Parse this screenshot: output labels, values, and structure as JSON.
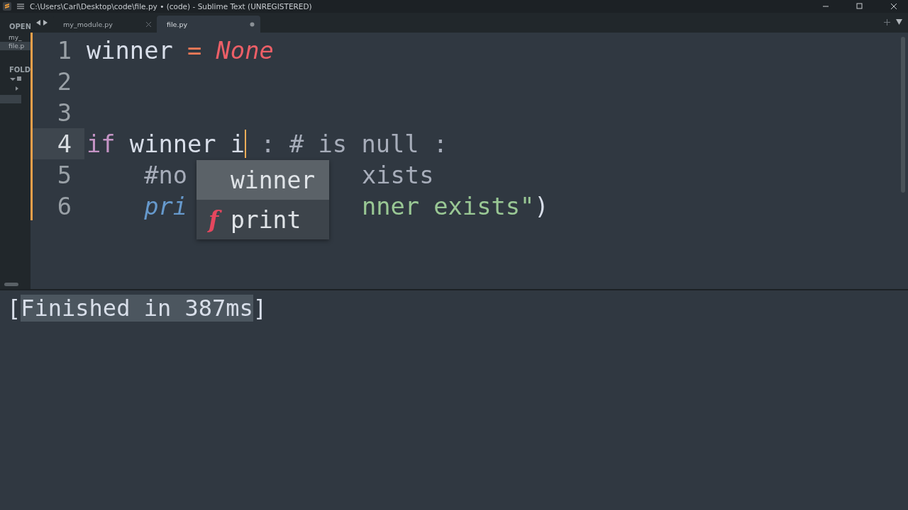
{
  "window": {
    "title": "C:\\Users\\Carl\\Desktop\\code\\file.py • (code) - Sublime Text (UNREGISTERED)"
  },
  "sidebar": {
    "open_header": "OPEN",
    "open_files": [
      {
        "label": "my_",
        "selected": false
      },
      {
        "label": "file.p",
        "selected": true
      }
    ],
    "folders_header": "FOLD"
  },
  "tabs": [
    {
      "label": "my_module.py",
      "selected": false,
      "dirty": false
    },
    {
      "label": "file.py",
      "selected": true,
      "dirty": true
    }
  ],
  "editor": {
    "lines": [
      {
        "number": "1",
        "current": false,
        "tokens": [
          {
            "text": "winner ",
            "kind": "plain"
          },
          {
            "text": "= ",
            "kind": "operator"
          },
          {
            "text": "None",
            "kind": "constant"
          }
        ]
      },
      {
        "number": "2",
        "current": false
      },
      {
        "number": "3",
        "current": false
      },
      {
        "number": "4",
        "current": true,
        "tokens": [
          {
            "text": "if ",
            "kind": "keyword"
          },
          {
            "text": "winner i",
            "kind": "plain"
          },
          {
            "kind": "cursor"
          },
          {
            "text": " : # is null :",
            "kind": "comment"
          }
        ]
      },
      {
        "number": "5",
        "current": false,
        "tokens": [
          {
            "text": "    #no ",
            "kind": "comment"
          },
          {
            "text": "xists",
            "kind": "comment-tail"
          }
        ]
      },
      {
        "number": "6",
        "current": false,
        "tokens": [
          {
            "text": "    pri",
            "kind": "function"
          },
          {
            "text": "nner exists\"",
            "kind": "string-tail"
          },
          {
            "text": ")",
            "kind": "plain"
          }
        ]
      }
    ],
    "completions": [
      {
        "label": "winner",
        "selected": true
      },
      {
        "icon": "f",
        "label": "print",
        "selected": false
      }
    ]
  },
  "output": {
    "open": "[",
    "text": "Finished in 387ms",
    "close": "]"
  }
}
